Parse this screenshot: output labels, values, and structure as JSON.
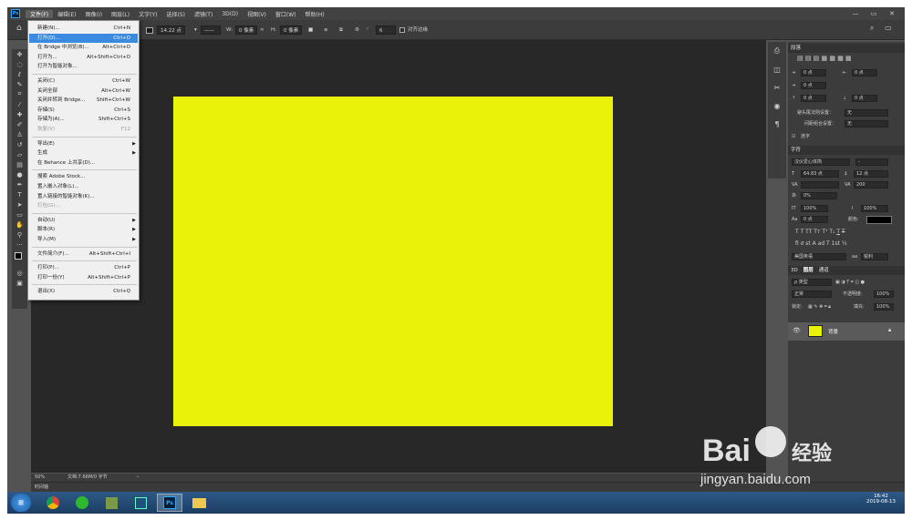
{
  "menubar": {
    "app_icon": "Ps",
    "items": [
      "文件(F)",
      "编辑(E)",
      "图像(I)",
      "图层(L)",
      "文字(Y)",
      "选择(S)",
      "滤镜(T)",
      "3D(D)",
      "视图(V)",
      "窗口(W)",
      "帮助(H)"
    ],
    "active_index": 0
  },
  "window_controls": {
    "minimize": "—",
    "restore": "▭",
    "close": "✕"
  },
  "options_bar": {
    "stroke_width": "14.22 点",
    "w_label": "W:",
    "w_value": "0 像素",
    "h_label": "H:",
    "h_value": "0 像素",
    "corner_value": "6",
    "align_edges": "对齐边缘"
  },
  "file_menu": {
    "items": [
      {
        "label": "新建(N)...",
        "shortcut": "Ctrl+N"
      },
      {
        "label": "打开(O)...",
        "shortcut": "Ctrl+O",
        "highlighted": true
      },
      {
        "label": "在 Bridge 中浏览(B)...",
        "shortcut": "Alt+Ctrl+O"
      },
      {
        "label": "打开为...",
        "shortcut": "Alt+Shift+Ctrl+O"
      },
      {
        "label": "打开为智能对象...",
        "shortcut": ""
      },
      {
        "sep": true
      },
      {
        "label": "关闭(C)",
        "shortcut": "Ctrl+W"
      },
      {
        "label": "关闭全部",
        "shortcut": "Alt+Ctrl+W"
      },
      {
        "label": "关闭并转到 Bridge...",
        "shortcut": "Shift+Ctrl+W"
      },
      {
        "label": "存储(S)",
        "shortcut": "Ctrl+S"
      },
      {
        "label": "存储为(A)...",
        "shortcut": "Shift+Ctrl+S"
      },
      {
        "label": "恢复(V)",
        "shortcut": "F12",
        "disabled": true
      },
      {
        "sep": true
      },
      {
        "label": "导出(E)",
        "shortcut": "",
        "submenu": true
      },
      {
        "label": "生成",
        "shortcut": "",
        "submenu": true
      },
      {
        "label": "在 Behance 上共享(D)...",
        "shortcut": ""
      },
      {
        "sep": true
      },
      {
        "label": "搜索 Adobe Stock...",
        "shortcut": ""
      },
      {
        "label": "置入嵌入对象(L)...",
        "shortcut": ""
      },
      {
        "label": "置入链接的智能对象(K)...",
        "shortcut": ""
      },
      {
        "label": "打包(G)...",
        "shortcut": "",
        "disabled": true
      },
      {
        "sep": true
      },
      {
        "label": "自动(U)",
        "shortcut": "",
        "submenu": true
      },
      {
        "label": "脚本(R)",
        "shortcut": "",
        "submenu": true
      },
      {
        "label": "导入(M)",
        "shortcut": "",
        "submenu": true
      },
      {
        "sep": true
      },
      {
        "label": "文件简介(F)...",
        "shortcut": "Alt+Shift+Ctrl+I"
      },
      {
        "sep": true
      },
      {
        "label": "打印(P)...",
        "shortcut": "Ctrl+P"
      },
      {
        "label": "打印一份(Y)",
        "shortcut": "Alt+Shift+Ctrl+P"
      },
      {
        "sep": true
      },
      {
        "label": "退出(X)",
        "shortcut": "Ctrl+Q"
      }
    ]
  },
  "canvas": {
    "fill_color": "#eaf20a"
  },
  "status_bar": {
    "zoom": "50%",
    "doc_info": "文档:7.66M/0 字节",
    "arrow": "›"
  },
  "timeline": {
    "label": "时间轴"
  },
  "paragraph_panel": {
    "tab": "段落",
    "indent_left": "0 点",
    "indent_right": "0 点",
    "indent_first": "0 点",
    "space_before": "0 点",
    "space_after": "0 点",
    "kinsoku_label": "避头尾法则设置：",
    "kinsoku_value": "无",
    "mojikumi_label": "间距组合设置：",
    "mojikumi_value": "无",
    "hyphenate": "连字"
  },
  "character_panel": {
    "tab": "字符",
    "font_family": "汉仪爱心体简",
    "font_style": "-",
    "font_size": "64.83 点",
    "leading": "12 点",
    "kerning": "",
    "tracking": "200",
    "tsume": "0%",
    "vertical_scale": "100%",
    "horizontal_scale": "100%",
    "baseline_shift": "0 点",
    "color_label": "颜色:",
    "language": "美国英语",
    "antialias": "锐利",
    "antialias_icon": "aa"
  },
  "layers_panel": {
    "tabs": [
      "3D",
      "图层",
      "通道"
    ],
    "active_tab": 1,
    "filter_label": "ρ 类型",
    "blend_mode": "正常",
    "opacity_label": "不透明度:",
    "opacity_value": "100%",
    "lock_label": "锁定:",
    "fill_label": "填充:",
    "fill_value": "100%",
    "layers": [
      {
        "name": "背景",
        "color": "#eaf20a"
      }
    ]
  },
  "taskbar": {
    "time": "16:42",
    "date": "2019-08-13",
    "ps_label": "Ps"
  },
  "watermark": {
    "brand": "Bai",
    "brand2": "经验",
    "url": "jingyan.baidu.com"
  }
}
